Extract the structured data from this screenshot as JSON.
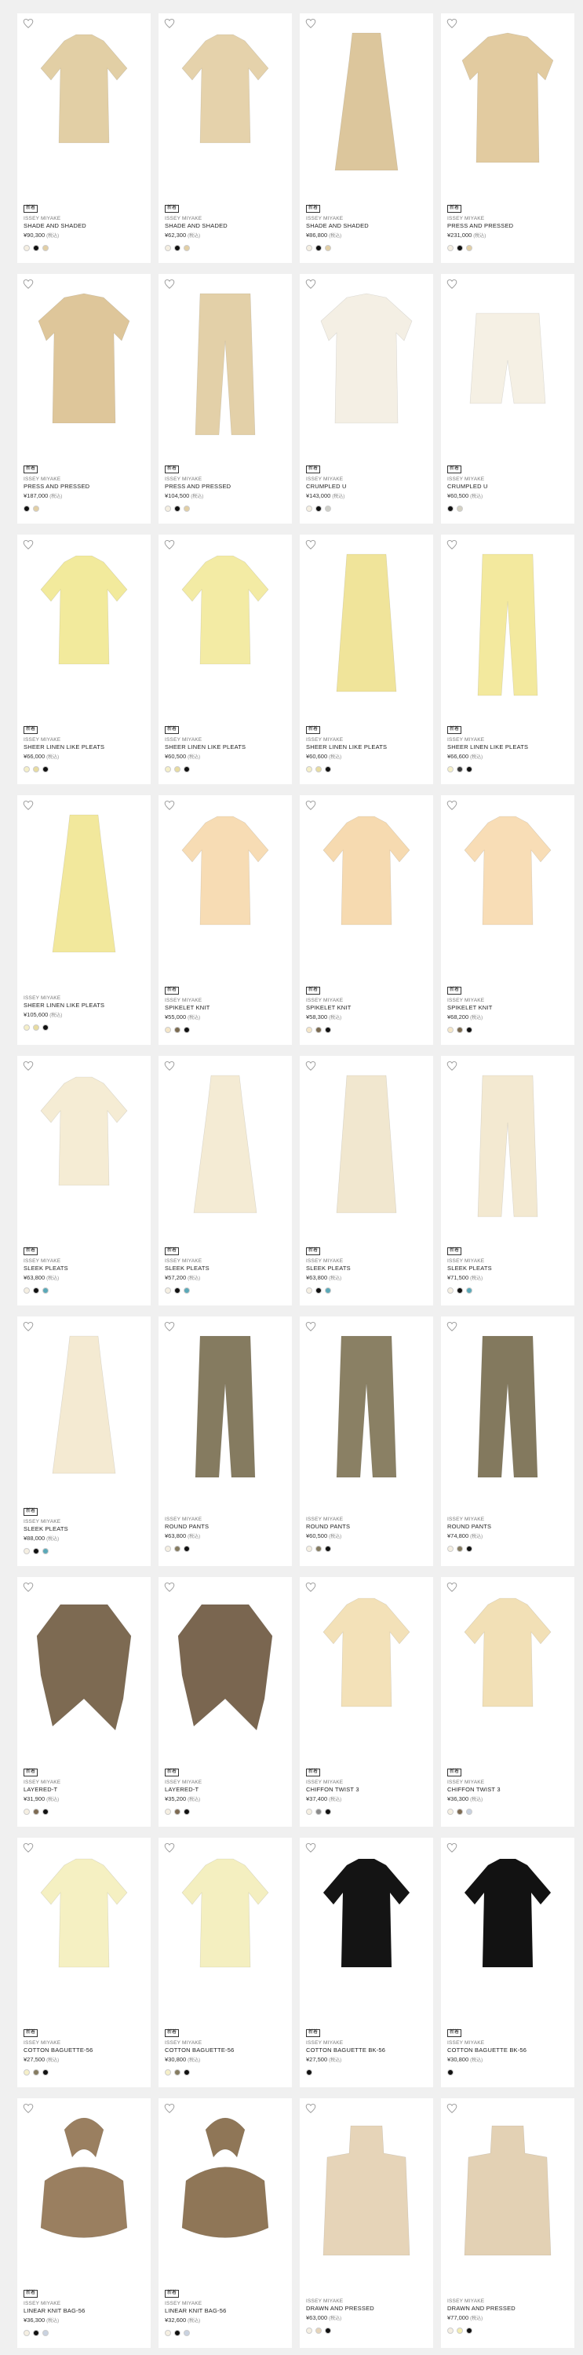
{
  "colors": {
    "bg": "#f0f0f0",
    "card": "#ffffff"
  },
  "products": [
    {
      "badge": "新着",
      "brand": "ISSEY MIYAKE",
      "name": "SHADE AND SHADED",
      "price": "¥90,300",
      "tax": "(税込)",
      "fill": "#e2cfa5",
      "shape": "top",
      "swatches": [
        "#f5efe2",
        "#111111",
        "#e2cfa5"
      ]
    },
    {
      "badge": "新着",
      "brand": "ISSEY MIYAKE",
      "name": "SHADE AND SHADED",
      "price": "¥62,300",
      "tax": "(税込)",
      "fill": "#e5d2ab",
      "shape": "top",
      "swatches": [
        "#f5efe2",
        "#111111",
        "#e2cfa5"
      ]
    },
    {
      "badge": "新着",
      "brand": "ISSEY MIYAKE",
      "name": "SHADE AND SHADED",
      "price": "¥86,800",
      "tax": "(税込)",
      "fill": "#dcc69c",
      "shape": "dress",
      "swatches": [
        "#f5efe2",
        "#111111",
        "#e2cfa5"
      ]
    },
    {
      "badge": "新着",
      "brand": "ISSEY MIYAKE",
      "name": "PRESS AND PRESSED",
      "price": "¥231,000",
      "tax": "(税込)",
      "fill": "#e2cba0",
      "shape": "coat",
      "swatches": [
        "#f5efe2",
        "#111111",
        "#e2cfa5"
      ]
    },
    {
      "badge": "新着",
      "brand": "ISSEY MIYAKE",
      "name": "PRESS AND PRESSED",
      "price": "¥187,000",
      "tax": "(税込)",
      "fill": "#dec69a",
      "shape": "coat",
      "swatches": [
        "#111111",
        "#e2cfa5"
      ]
    },
    {
      "badge": "新着",
      "brand": "ISSEY MIYAKE",
      "name": "PRESS AND PRESSED",
      "price": "¥104,500",
      "tax": "(税込)",
      "fill": "#e3d0a8",
      "shape": "pants",
      "swatches": [
        "#f5efe2",
        "#111111",
        "#e2cfa5"
      ]
    },
    {
      "badge": "新着",
      "brand": "ISSEY MIYAKE",
      "name": "CRUMPLED U",
      "price": "¥143,000",
      "tax": "(税込)",
      "fill": "#f4efe4",
      "shape": "coat",
      "swatches": [
        "#f5efe2",
        "#111111",
        "#cfcfc9"
      ]
    },
    {
      "badge": "新着",
      "brand": "ISSEY MIYAKE",
      "name": "CRUMPLED U",
      "price": "¥60,500",
      "tax": "(税込)",
      "fill": "#f5f0e4",
      "shape": "shorts",
      "swatches": [
        "#111111",
        "#d4d1c2"
      ]
    },
    {
      "badge": "新着",
      "brand": "ISSEY MIYAKE",
      "name": "SHEER LINEN LIKE PLEATS",
      "price": "¥66,000",
      "tax": "(税込)",
      "fill": "#f2ea9c",
      "shape": "top",
      "swatches": [
        "#f5efc8",
        "#e8dca0",
        "#111111"
      ]
    },
    {
      "badge": "新着",
      "brand": "ISSEY MIYAKE",
      "name": "SHEER LINEN LIKE PLEATS",
      "price": "¥60,500",
      "tax": "(税込)",
      "fill": "#f3eba4",
      "shape": "top",
      "swatches": [
        "#f5efc8",
        "#e8dca0",
        "#111111"
      ]
    },
    {
      "badge": "新着",
      "brand": "ISSEY MIYAKE",
      "name": "SHEER LINEN LIKE PLEATS",
      "price": "¥60,600",
      "tax": "(税込)",
      "fill": "#f0e49a",
      "shape": "skirt",
      "swatches": [
        "#f5efc8",
        "#e8dca0",
        "#111111"
      ]
    },
    {
      "badge": "新着",
      "brand": "ISSEY MIYAKE",
      "name": "SHEER LINEN LIKE PLEATS",
      "price": "¥66,600",
      "tax": "(税込)",
      "fill": "#f3e99e",
      "shape": "pants",
      "swatches": [
        "#f5efc8",
        "#3a3a3a",
        "#111111"
      ]
    },
    {
      "badge": "",
      "brand": "ISSEY MIYAKE",
      "name": "SHEER LINEN LIKE PLEATS",
      "price": "¥105,600",
      "tax": "(税込)",
      "fill": "#f2e89c",
      "shape": "dress",
      "swatches": [
        "#f5efc8",
        "#e8dca0",
        "#111111"
      ]
    },
    {
      "badge": "新着",
      "brand": "ISSEY MIYAKE",
      "name": "SPIKELET KNIT",
      "price": "¥55,000",
      "tax": "(税込)",
      "fill": "#f7dcb4",
      "shape": "top",
      "swatches": [
        "#f5e6c8",
        "#7a6a50",
        "#111111"
      ]
    },
    {
      "badge": "新着",
      "brand": "ISSEY MIYAKE",
      "name": "SPIKELET KNIT",
      "price": "¥58,300",
      "tax": "(税込)",
      "fill": "#f6dab0",
      "shape": "top",
      "swatches": [
        "#f5e6c8",
        "#7a6a50",
        "#111111"
      ]
    },
    {
      "badge": "新着",
      "brand": "ISSEY MIYAKE",
      "name": "SPIKELET KNIT",
      "price": "¥68,200",
      "tax": "(税込)",
      "fill": "#f8ddb6",
      "shape": "top",
      "swatches": [
        "#f5e6c8",
        "#7a6a50",
        "#111111"
      ]
    },
    {
      "badge": "新着",
      "brand": "ISSEY MIYAKE",
      "name": "SLEEK PLEATS",
      "price": "¥63,800",
      "tax": "(税込)",
      "fill": "#f5ecd4",
      "shape": "top",
      "swatches": [
        "#f5efe2",
        "#111111",
        "#5aa9b8"
      ]
    },
    {
      "badge": "新着",
      "brand": "ISSEY MIYAKE",
      "name": "SLEEK PLEATS",
      "price": "¥57,200",
      "tax": "(税込)",
      "fill": "#f4ebd4",
      "shape": "dress",
      "swatches": [
        "#f5efe2",
        "#111111",
        "#5aa9b8"
      ]
    },
    {
      "badge": "新着",
      "brand": "ISSEY MIYAKE",
      "name": "SLEEK PLEATS",
      "price": "¥63,800",
      "tax": "(税込)",
      "fill": "#f1e7cf",
      "shape": "skirt",
      "swatches": [
        "#f5efe2",
        "#111111",
        "#5aa9b8"
      ]
    },
    {
      "badge": "新着",
      "brand": "ISSEY MIYAKE",
      "name": "SLEEK PLEATS",
      "price": "¥71,500",
      "tax": "(税込)",
      "fill": "#f3e9d1",
      "shape": "pants",
      "swatches": [
        "#f5efe2",
        "#111111",
        "#5aa9b8"
      ]
    },
    {
      "badge": "新着",
      "brand": "ISSEY MIYAKE",
      "name": "SLEEK PLEATS",
      "price": "¥88,000",
      "tax": "(税込)",
      "fill": "#f4ead2",
      "shape": "dress",
      "swatches": [
        "#f5efe2",
        "#111111",
        "#5aa9b8"
      ]
    },
    {
      "badge": "",
      "brand": "ISSEY MIYAKE",
      "name": "ROUND PANTS",
      "price": "¥63,800",
      "tax": "(税込)",
      "fill": "#857b60",
      "shape": "pants",
      "swatches": [
        "#f5efe2",
        "#857b60",
        "#111111"
      ]
    },
    {
      "badge": "",
      "brand": "ISSEY MIYAKE",
      "name": "ROUND PANTS",
      "price": "¥60,500",
      "tax": "(税込)",
      "fill": "#8a8064",
      "shape": "pants",
      "swatches": [
        "#f5efe2",
        "#857b60",
        "#111111"
      ]
    },
    {
      "badge": "",
      "brand": "ISSEY MIYAKE",
      "name": "ROUND PANTS",
      "price": "¥74,800",
      "tax": "(税込)",
      "fill": "#83795e",
      "shape": "pants",
      "swatches": [
        "#f5efe2",
        "#857b60",
        "#111111"
      ]
    },
    {
      "badge": "新着",
      "brand": "ISSEY MIYAKE",
      "name": "LAYERED-T",
      "price": "¥31,900",
      "tax": "(税込)",
      "fill": "#7d6a52",
      "shape": "layered",
      "swatches": [
        "#f5efe2",
        "#7d6a52",
        "#111111"
      ]
    },
    {
      "badge": "新着",
      "brand": "ISSEY MIYAKE",
      "name": "LAYERED-T",
      "price": "¥35,200",
      "tax": "(税込)",
      "fill": "#7a6650",
      "shape": "layered",
      "swatches": [
        "#f5efe2",
        "#7d6a52",
        "#111111"
      ]
    },
    {
      "badge": "新着",
      "brand": "ISSEY MIYAKE",
      "name": "CHIFFON TWIST 3",
      "price": "¥37,400",
      "tax": "(税込)",
      "fill": "#f3e1b8",
      "shape": "top",
      "swatches": [
        "#f5efe2",
        "#8a8a8a",
        "#111111"
      ]
    },
    {
      "badge": "新着",
      "brand": "ISSEY MIYAKE",
      "name": "CHIFFON TWIST 3",
      "price": "¥36,300",
      "tax": "(税込)",
      "fill": "#f2e0b6",
      "shape": "top",
      "swatches": [
        "#f5efe2",
        "#7d6a52",
        "#c9d2e0"
      ]
    },
    {
      "badge": "新着",
      "brand": "ISSEY MIYAKE",
      "name": "COTTON BAGUETTE-56",
      "price": "¥27,500",
      "tax": "(税込)",
      "fill": "#f5f0c2",
      "shape": "top",
      "swatches": [
        "#f5efc8",
        "#857b60",
        "#111111"
      ]
    },
    {
      "badge": "新着",
      "brand": "ISSEY MIYAKE",
      "name": "COTTON BAGUETTE-56",
      "price": "¥30,800",
      "tax": "(税込)",
      "fill": "#f4efc0",
      "shape": "top",
      "swatches": [
        "#f5efc8",
        "#857b60",
        "#111111"
      ]
    },
    {
      "badge": "新着",
      "brand": "ISSEY MIYAKE",
      "name": "COTTON BAGUETTE BK-56",
      "price": "¥27,500",
      "tax": "(税込)",
      "fill": "#141414",
      "shape": "top",
      "swatches": [
        "#111111"
      ]
    },
    {
      "badge": "新着",
      "brand": "ISSEY MIYAKE",
      "name": "COTTON BAGUETTE BK-56",
      "price": "¥30,800",
      "tax": "(税込)",
      "fill": "#121212",
      "shape": "top",
      "swatches": [
        "#111111"
      ]
    },
    {
      "badge": "新着",
      "brand": "ISSEY MIYAKE",
      "name": "LINEAR KNIT BAG-56",
      "price": "¥36,300",
      "tax": "(税込)",
      "fill": "#9a7f60",
      "shape": "bag",
      "swatches": [
        "#f5efe2",
        "#111111",
        "#c9d2e0"
      ]
    },
    {
      "badge": "新着",
      "brand": "ISSEY MIYAKE",
      "name": "LINEAR KNIT BAG-56",
      "price": "¥32,600",
      "tax": "(税込)",
      "fill": "#8f7657",
      "shape": "bag",
      "swatches": [
        "#f5efe2",
        "#111111",
        "#c9d2e0"
      ]
    },
    {
      "badge": "",
      "brand": "ISSEY MIYAKE",
      "name": "DRAWN AND PRESSED",
      "price": "¥63,000",
      "tax": "(税込)",
      "fill": "#e6d4b8",
      "shape": "tote",
      "swatches": [
        "#f5efe2",
        "#e6d4b8",
        "#111111"
      ]
    },
    {
      "badge": "",
      "brand": "ISSEY MIYAKE",
      "name": "DRAWN AND PRESSED",
      "price": "¥77,000",
      "tax": "(税込)",
      "fill": "#e3d1b4",
      "shape": "tote",
      "swatches": [
        "#f5efe2",
        "#f3ecb0",
        "#111111"
      ]
    }
  ]
}
